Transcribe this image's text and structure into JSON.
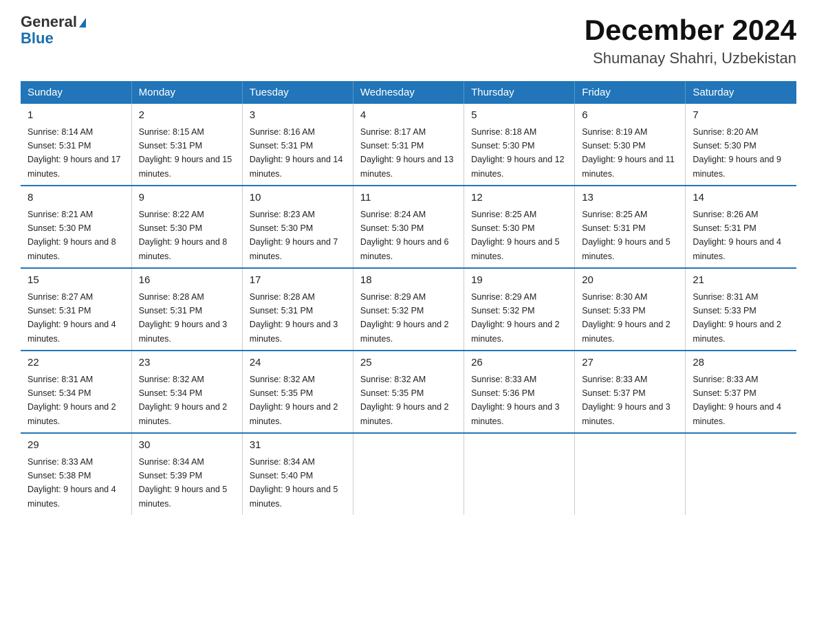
{
  "logo": {
    "line1": "General",
    "line2": "Blue"
  },
  "title": "December 2024",
  "subtitle": "Shumanay Shahri, Uzbekistan",
  "days_of_week": [
    "Sunday",
    "Monday",
    "Tuesday",
    "Wednesday",
    "Thursday",
    "Friday",
    "Saturday"
  ],
  "weeks": [
    [
      {
        "day": "1",
        "sunrise": "8:14 AM",
        "sunset": "5:31 PM",
        "daylight": "9 hours and 17 minutes."
      },
      {
        "day": "2",
        "sunrise": "8:15 AM",
        "sunset": "5:31 PM",
        "daylight": "9 hours and 15 minutes."
      },
      {
        "day": "3",
        "sunrise": "8:16 AM",
        "sunset": "5:31 PM",
        "daylight": "9 hours and 14 minutes."
      },
      {
        "day": "4",
        "sunrise": "8:17 AM",
        "sunset": "5:31 PM",
        "daylight": "9 hours and 13 minutes."
      },
      {
        "day": "5",
        "sunrise": "8:18 AM",
        "sunset": "5:30 PM",
        "daylight": "9 hours and 12 minutes."
      },
      {
        "day": "6",
        "sunrise": "8:19 AM",
        "sunset": "5:30 PM",
        "daylight": "9 hours and 11 minutes."
      },
      {
        "day": "7",
        "sunrise": "8:20 AM",
        "sunset": "5:30 PM",
        "daylight": "9 hours and 9 minutes."
      }
    ],
    [
      {
        "day": "8",
        "sunrise": "8:21 AM",
        "sunset": "5:30 PM",
        "daylight": "9 hours and 8 minutes."
      },
      {
        "day": "9",
        "sunrise": "8:22 AM",
        "sunset": "5:30 PM",
        "daylight": "9 hours and 8 minutes."
      },
      {
        "day": "10",
        "sunrise": "8:23 AM",
        "sunset": "5:30 PM",
        "daylight": "9 hours and 7 minutes."
      },
      {
        "day": "11",
        "sunrise": "8:24 AM",
        "sunset": "5:30 PM",
        "daylight": "9 hours and 6 minutes."
      },
      {
        "day": "12",
        "sunrise": "8:25 AM",
        "sunset": "5:30 PM",
        "daylight": "9 hours and 5 minutes."
      },
      {
        "day": "13",
        "sunrise": "8:25 AM",
        "sunset": "5:31 PM",
        "daylight": "9 hours and 5 minutes."
      },
      {
        "day": "14",
        "sunrise": "8:26 AM",
        "sunset": "5:31 PM",
        "daylight": "9 hours and 4 minutes."
      }
    ],
    [
      {
        "day": "15",
        "sunrise": "8:27 AM",
        "sunset": "5:31 PM",
        "daylight": "9 hours and 4 minutes."
      },
      {
        "day": "16",
        "sunrise": "8:28 AM",
        "sunset": "5:31 PM",
        "daylight": "9 hours and 3 minutes."
      },
      {
        "day": "17",
        "sunrise": "8:28 AM",
        "sunset": "5:31 PM",
        "daylight": "9 hours and 3 minutes."
      },
      {
        "day": "18",
        "sunrise": "8:29 AM",
        "sunset": "5:32 PM",
        "daylight": "9 hours and 2 minutes."
      },
      {
        "day": "19",
        "sunrise": "8:29 AM",
        "sunset": "5:32 PM",
        "daylight": "9 hours and 2 minutes."
      },
      {
        "day": "20",
        "sunrise": "8:30 AM",
        "sunset": "5:33 PM",
        "daylight": "9 hours and 2 minutes."
      },
      {
        "day": "21",
        "sunrise": "8:31 AM",
        "sunset": "5:33 PM",
        "daylight": "9 hours and 2 minutes."
      }
    ],
    [
      {
        "day": "22",
        "sunrise": "8:31 AM",
        "sunset": "5:34 PM",
        "daylight": "9 hours and 2 minutes."
      },
      {
        "day": "23",
        "sunrise": "8:32 AM",
        "sunset": "5:34 PM",
        "daylight": "9 hours and 2 minutes."
      },
      {
        "day": "24",
        "sunrise": "8:32 AM",
        "sunset": "5:35 PM",
        "daylight": "9 hours and 2 minutes."
      },
      {
        "day": "25",
        "sunrise": "8:32 AM",
        "sunset": "5:35 PM",
        "daylight": "9 hours and 2 minutes."
      },
      {
        "day": "26",
        "sunrise": "8:33 AM",
        "sunset": "5:36 PM",
        "daylight": "9 hours and 3 minutes."
      },
      {
        "day": "27",
        "sunrise": "8:33 AM",
        "sunset": "5:37 PM",
        "daylight": "9 hours and 3 minutes."
      },
      {
        "day": "28",
        "sunrise": "8:33 AM",
        "sunset": "5:37 PM",
        "daylight": "9 hours and 4 minutes."
      }
    ],
    [
      {
        "day": "29",
        "sunrise": "8:33 AM",
        "sunset": "5:38 PM",
        "daylight": "9 hours and 4 minutes."
      },
      {
        "day": "30",
        "sunrise": "8:34 AM",
        "sunset": "5:39 PM",
        "daylight": "9 hours and 5 minutes."
      },
      {
        "day": "31",
        "sunrise": "8:34 AM",
        "sunset": "5:40 PM",
        "daylight": "9 hours and 5 minutes."
      },
      null,
      null,
      null,
      null
    ]
  ]
}
